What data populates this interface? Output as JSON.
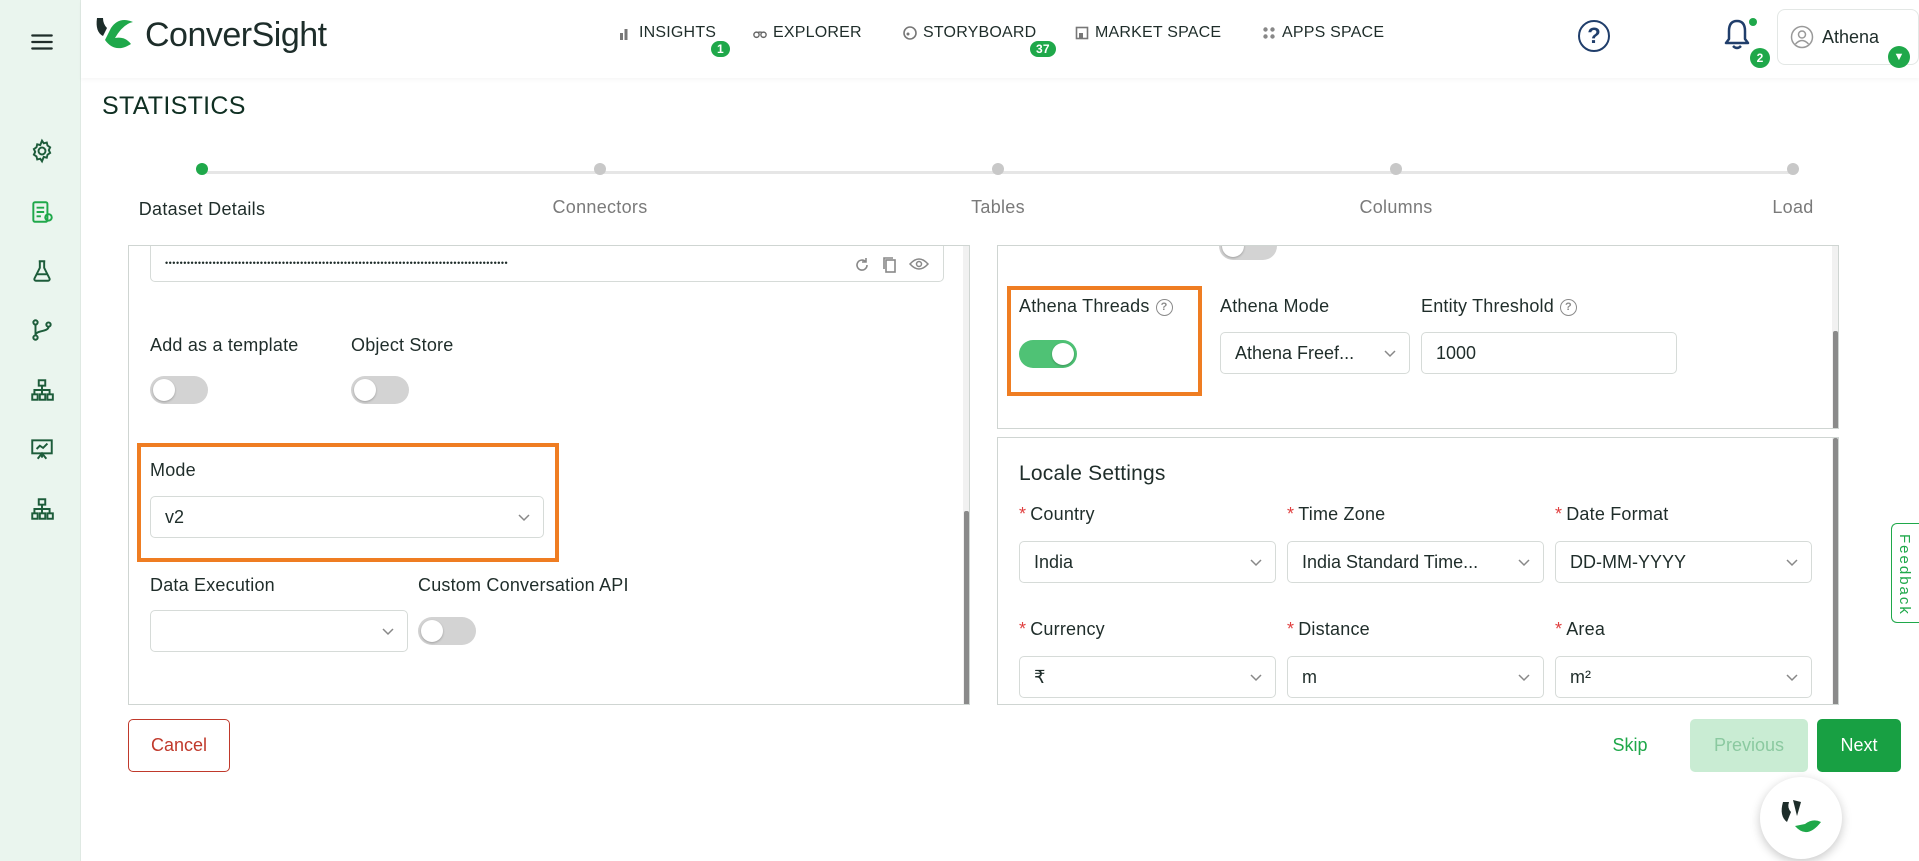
{
  "app": {
    "brand": "ConverSight",
    "accent": "#1fa84a",
    "highlight": "#ef7d22"
  },
  "topnav": {
    "items": [
      {
        "label": "INSIGHTS",
        "icon": "bar-chart-icon",
        "badge": "1"
      },
      {
        "label": "EXPLORER",
        "icon": "binoculars-icon",
        "badge": ""
      },
      {
        "label": "STORYBOARD",
        "icon": "palette-icon",
        "badge": "37"
      },
      {
        "label": "MARKET SPACE",
        "icon": "store-icon",
        "badge": ""
      },
      {
        "label": "APPS SPACE",
        "icon": "apps-grid-icon",
        "badge": ""
      }
    ],
    "notification_count": "2",
    "user_name": "Athena"
  },
  "page": {
    "title": "STATISTICS"
  },
  "stepper": {
    "steps": [
      {
        "label": "Dataset Details",
        "active": true
      },
      {
        "label": "Connectors",
        "active": false
      },
      {
        "label": "Tables",
        "active": false
      },
      {
        "label": "Columns",
        "active": false
      },
      {
        "label": "Load",
        "active": false
      }
    ]
  },
  "left_panel": {
    "password_masked": "••••••••••••••••••••••••••••••••••••••••••••••••••••••••••••••••••••••••••••••••••••••••••••••",
    "add_template_label": "Add as a template",
    "add_template_on": false,
    "object_store_label": "Object Store",
    "object_store_on": false,
    "mode_label": "Mode",
    "mode_value": "v2",
    "data_execution_label": "Data Execution",
    "data_execution_value": "",
    "custom_api_label": "Custom Conversation API",
    "custom_api_on": false
  },
  "right_top_panel": {
    "athena_threads_label": "Athena Threads",
    "athena_threads_on": true,
    "athena_mode_label": "Athena Mode",
    "athena_mode_value": "Athena Freef...",
    "entity_threshold_label": "Entity Threshold",
    "entity_threshold_value": "1000"
  },
  "locale": {
    "title": "Locale Settings",
    "country_label": "Country",
    "country_value": "India",
    "timezone_label": "Time Zone",
    "timezone_value": "India Standard Time...",
    "date_format_label": "Date Format",
    "date_format_value": "DD-MM-YYYY",
    "currency_label": "Currency",
    "currency_value": "₹",
    "distance_label": "Distance",
    "distance_value": "m",
    "area_label": "Area",
    "area_value": "m²"
  },
  "actions": {
    "cancel": "Cancel",
    "skip": "Skip",
    "previous": "Previous",
    "next": "Next"
  },
  "feedback": "Feedback"
}
